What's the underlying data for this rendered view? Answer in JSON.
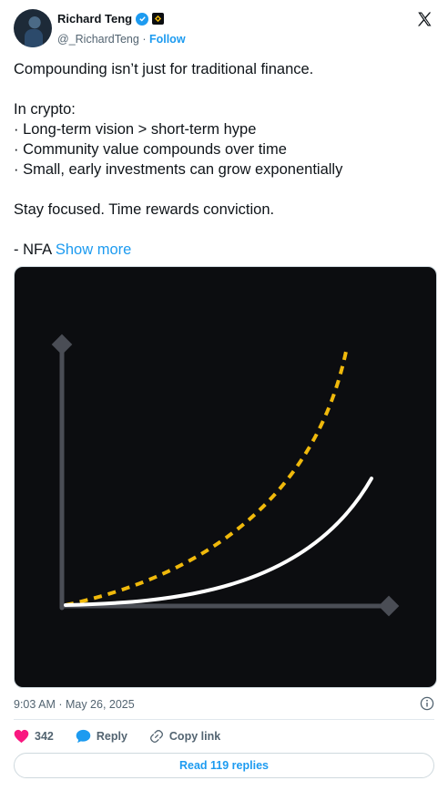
{
  "author": {
    "display_name": "Richard Teng",
    "handle": "@_RichardTeng",
    "separator": "·",
    "follow_label": "Follow"
  },
  "icons": {
    "verified": "verified-badge-icon",
    "affiliate": "binance-logo-icon",
    "platform": "x-logo-icon",
    "info": "info-icon",
    "like": "heart-icon",
    "reply": "reply-bubble-icon",
    "copy": "link-icon"
  },
  "tweet": {
    "line1": "Compounding isn’t just for traditional finance.",
    "line2": "In crypto:",
    "bullet1": "· Long-term vision > short-term hype",
    "bullet2": "· Community value compounds over time",
    "bullet3": "· Small, early investments can grow exponentially",
    "line3": "Stay focused. Time rewards conviction.",
    "line4": "- NFA",
    "show_more": "Show more"
  },
  "timestamp": "9:03 AM · May 26, 2025",
  "actions": {
    "likes": "342",
    "reply_label": "Reply",
    "copy_label": "Copy link"
  },
  "read_replies_label": "Read 119 replies",
  "colors": {
    "accent": "#1d9bf0",
    "like": "#f91880",
    "media_bg": "#0c0d10",
    "dashed_curve": "#f0b90b",
    "solid_curve": "#ffffff",
    "axis": "#4a4d55"
  }
}
